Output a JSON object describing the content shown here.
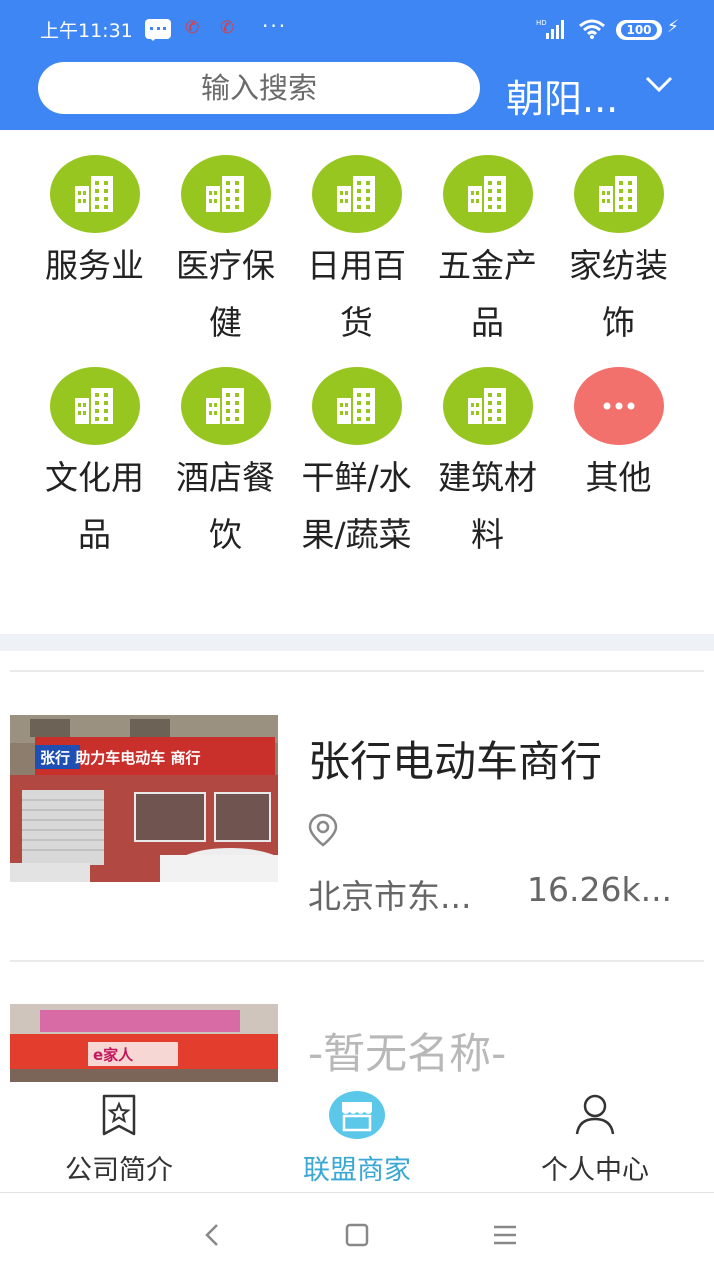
{
  "status_bar": {
    "time": "上午11:31",
    "more": "···",
    "battery": "100"
  },
  "header": {
    "search_placeholder": "输入搜索",
    "city": "朝阳..."
  },
  "categories": [
    {
      "label": "服务业",
      "icon": "building-icon"
    },
    {
      "label": "医疗保健",
      "icon": "building-icon"
    },
    {
      "label": "日用百货",
      "icon": "building-icon"
    },
    {
      "label": "五金产品",
      "icon": "building-icon"
    },
    {
      "label": "家纺装饰",
      "icon": "building-icon"
    },
    {
      "label": "文化用品",
      "icon": "building-icon"
    },
    {
      "label": "酒店餐饮",
      "icon": "building-icon"
    },
    {
      "label": "干鲜/水果/蔬菜",
      "icon": "building-icon"
    },
    {
      "label": "建筑材料",
      "icon": "building-icon"
    },
    {
      "label": "其他",
      "icon": "more-dots-icon"
    }
  ],
  "merchants": [
    {
      "name": "张行电动车商行",
      "sign_text": "张行 助力车电动车 商行",
      "address": "北京市东...",
      "distance": "16.26k..."
    },
    {
      "name": "-暂无名称-",
      "sign_text": "e家人"
    }
  ],
  "tabbar": {
    "tabs": [
      {
        "label": "公司简介",
        "icon": "bookmark-star-icon"
      },
      {
        "label": "联盟商家",
        "icon": "store-icon"
      },
      {
        "label": "个人中心",
        "icon": "person-icon"
      }
    ],
    "active_color": "#3aa7d4"
  },
  "colors": {
    "header_bg": "#3d86f3",
    "category_green": "#98c620",
    "other_red": "#f2716c"
  }
}
